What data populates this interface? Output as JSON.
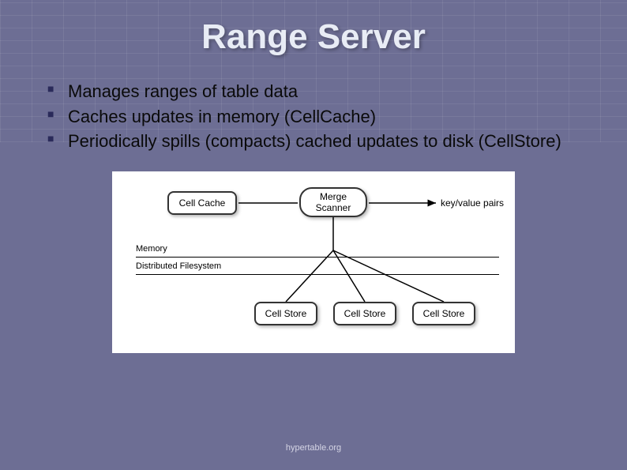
{
  "title": "Range Server",
  "bullets": [
    "Manages ranges of table data",
    "Caches updates in memory (CellCache)",
    "Periodically spills (compacts) cached updates to disk (CellStore)"
  ],
  "diagram": {
    "cell_cache": "Cell Cache",
    "merge_scanner": "Merge\nScanner",
    "output_label": "key/value pairs",
    "memory_label": "Memory",
    "fs_label": "Distributed Filesystem",
    "cell_store": "Cell Store"
  },
  "footer": "hypertable.org"
}
